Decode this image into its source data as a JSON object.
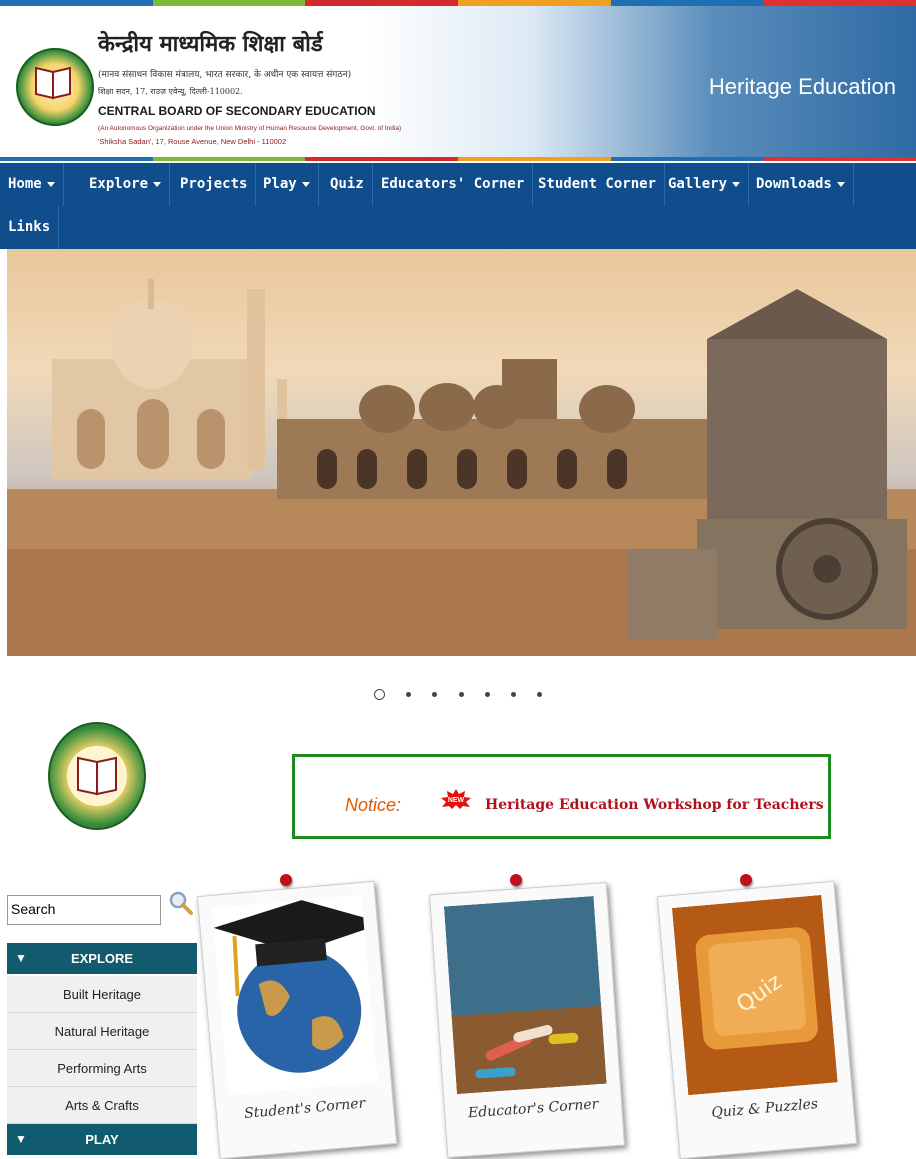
{
  "header": {
    "hindi_title": "केन्द्रीय माध्यमिक शिक्षा बोर्ड",
    "hindi_subtitle": "(मानव संसाधन विकास मंत्रालय, भारत सरकार, के अधीन एक स्वायत्त संगठन)",
    "hindi_address": "शिक्षा सदन, 17, राउज़ एवेन्यू, दिल्ली-110002.",
    "english_title": "CENTRAL BOARD OF SECONDARY EDUCATION",
    "english_subtitle": "(An Autonomous Organization under the Union Ministry of Human Resource Development, Govt. of India)",
    "english_address": "'Shiksha Sadan', 17, Rouse Avenue, New Delhi - 110002",
    "site_title": "Heritage Education"
  },
  "nav": {
    "items": [
      {
        "label": "Home",
        "dropdown": true
      },
      {
        "label": "Explore",
        "dropdown": true
      },
      {
        "label": "Projects",
        "dropdown": false
      },
      {
        "label": "Play",
        "dropdown": true
      },
      {
        "label": "Quiz",
        "dropdown": false
      },
      {
        "label": "Educators' Corner",
        "dropdown": false
      },
      {
        "label": "Student Corner",
        "dropdown": false
      },
      {
        "label": "Gallery",
        "dropdown": true
      },
      {
        "label": "Downloads",
        "dropdown": true
      },
      {
        "label": "Links",
        "dropdown": false
      }
    ]
  },
  "slider": {
    "slide_count": 7,
    "active_index": 0
  },
  "notice": {
    "label": "Notice:",
    "badge": "NEW",
    "text": "Heritage Education Workshop for Teachers"
  },
  "search": {
    "value": "Search"
  },
  "sidebar": {
    "sections": [
      {
        "title": "EXPLORE",
        "items": [
          "Built Heritage",
          "Natural Heritage",
          "Performing Arts",
          "Arts & Crafts"
        ]
      },
      {
        "title": "PLAY",
        "items": []
      }
    ]
  },
  "cards": [
    {
      "caption": "Student's Corner",
      "icon": "graduation-globe-icon"
    },
    {
      "caption": "Educator's Corner",
      "icon": "chalk-board-icon"
    },
    {
      "caption": "Quiz & Puzzles",
      "icon": "quiz-key-icon"
    }
  ],
  "colors": {
    "nav_bg": "#0f4d8c",
    "menu_head": "#125a6e",
    "notice_border": "#1e8c1e",
    "notice_text": "#b0121a",
    "notice_label": "#e05a00"
  }
}
